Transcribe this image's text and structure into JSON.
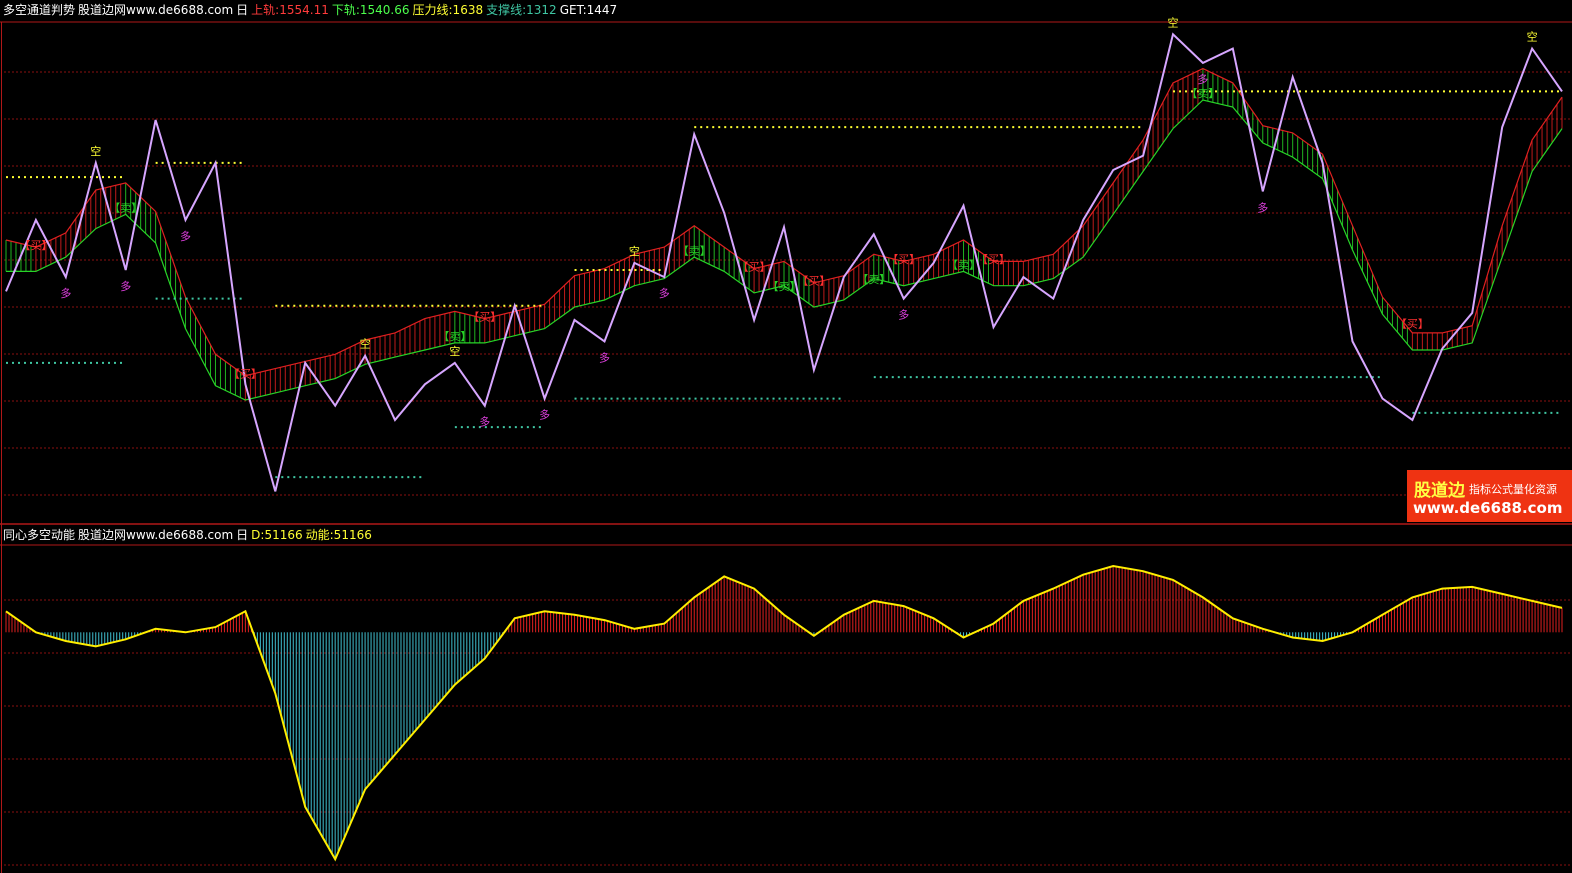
{
  "top_header": {
    "name": "多空通道判势",
    "source": "股道边网www.de6688.com",
    "period": "日",
    "upper_label": "上轨:1554.11",
    "lower_label": "下轨:1540.66",
    "pressure_label": "压力线:1638",
    "support_label": "支撑线:1312",
    "get_label": "GET:1447"
  },
  "bottom_header": {
    "name": "同心多空动能",
    "source": "股道边网www.de6688.com",
    "period": "日",
    "d_label": "D:51166",
    "momentum_label": "动能:51166"
  },
  "watermark": {
    "brand": "股道边",
    "tagline": "指标公式量化资源",
    "url": "www.de6688.com"
  },
  "signals": {
    "buy": "多",
    "sell": "空",
    "sell_box": "【卖】",
    "buy_box": "【买】"
  },
  "colors": {
    "price_line": "#d6a6ff",
    "band_red": "#e02020",
    "band_green": "#27d427",
    "pressure": "#ffff33",
    "support": "#3fc6a3",
    "momentum_line": "#ffee00",
    "momentum_pos": "#e02020",
    "momentum_neg": "#40c0d0",
    "grid": "#8a1010"
  },
  "chart_data": [
    {
      "type": "line",
      "title": "多空通道判势",
      "x": [
        0,
        5,
        10,
        15,
        20,
        25,
        30,
        35,
        40,
        45,
        50,
        55,
        60,
        65,
        70,
        75,
        80,
        85,
        90,
        95,
        100,
        105,
        110,
        115,
        120,
        125,
        130,
        135,
        140,
        145,
        150,
        155,
        160,
        165,
        170,
        175,
        180,
        185,
        190,
        195,
        200,
        205,
        210,
        215,
        220,
        225,
        230,
        235,
        240,
        245,
        250,
        255,
        260
      ],
      "series": [
        {
          "role": "price",
          "values": [
            1420,
            1520,
            1440,
            1600,
            1450,
            1660,
            1520,
            1600,
            1290,
            1140,
            1320,
            1260,
            1330,
            1240,
            1290,
            1320,
            1260,
            1400,
            1270,
            1380,
            1350,
            1460,
            1440,
            1640,
            1530,
            1380,
            1510,
            1310,
            1440,
            1500,
            1410,
            1460,
            1540,
            1370,
            1440,
            1410,
            1520,
            1590,
            1610,
            1780,
            1740,
            1760,
            1560,
            1720,
            1600,
            1350,
            1270,
            1240,
            1340,
            1390,
            1650,
            1760,
            1700
          ]
        },
        {
          "role": "band_upper",
          "values": [
            1480,
            1470,
            1490,
            1550,
            1560,
            1520,
            1400,
            1320,
            1290,
            1300,
            1310,
            1320,
            1340,
            1350,
            1370,
            1380,
            1370,
            1380,
            1390,
            1430,
            1440,
            1460,
            1470,
            1500,
            1470,
            1440,
            1450,
            1420,
            1430,
            1460,
            1450,
            1460,
            1480,
            1450,
            1450,
            1460,
            1500,
            1560,
            1620,
            1700,
            1720,
            1700,
            1640,
            1630,
            1600,
            1500,
            1400,
            1350,
            1350,
            1360,
            1500,
            1620,
            1680
          ]
        },
        {
          "role": "band_lower",
          "values": [
            1460,
            1460,
            1480,
            1520,
            1540,
            1500,
            1380,
            1300,
            1280,
            1290,
            1300,
            1310,
            1330,
            1340,
            1350,
            1360,
            1360,
            1370,
            1380,
            1410,
            1420,
            1440,
            1450,
            1480,
            1460,
            1430,
            1440,
            1410,
            1420,
            1450,
            1440,
            1450,
            1460,
            1440,
            1440,
            1450,
            1480,
            1540,
            1600,
            1660,
            1700,
            1690,
            1640,
            1620,
            1590,
            1490,
            1400,
            1350,
            1350,
            1360,
            1480,
            1600,
            1660
          ]
        },
        {
          "role": "pressure",
          "values": [
            1580,
            1580,
            1580,
            1580,
            1580,
            1600,
            1600,
            1600,
            1600,
            1400,
            1400,
            1400,
            1400,
            1400,
            1400,
            1400,
            1400,
            1400,
            1400,
            1450,
            1450,
            1450,
            1450,
            1650,
            1650,
            1650,
            1650,
            1650,
            1650,
            1650,
            1650,
            1650,
            1650,
            1650,
            1650,
            1650,
            1650,
            1650,
            1650,
            1700,
            1700,
            1700,
            1700,
            1700,
            1700,
            1700,
            1700,
            1700,
            1700,
            1700,
            1700,
            1700,
            1700
          ]
        },
        {
          "role": "support",
          "values": [
            1320,
            1320,
            1320,
            1320,
            1320,
            1410,
            1410,
            1410,
            1410,
            1160,
            1160,
            1160,
            1160,
            1160,
            1160,
            1230,
            1230,
            1230,
            1230,
            1270,
            1270,
            1270,
            1270,
            1270,
            1270,
            1270,
            1270,
            1270,
            1270,
            1300,
            1300,
            1300,
            1300,
            1300,
            1300,
            1300,
            1300,
            1300,
            1300,
            1300,
            1300,
            1300,
            1300,
            1300,
            1300,
            1300,
            1300,
            1250,
            1250,
            1250,
            1250,
            1250,
            1250
          ]
        }
      ],
      "ylim": [
        1100,
        1800
      ]
    },
    {
      "type": "bar",
      "title": "同心多空动能",
      "x": [
        0,
        5,
        10,
        15,
        20,
        25,
        30,
        35,
        40,
        45,
        50,
        55,
        60,
        65,
        70,
        75,
        80,
        85,
        90,
        95,
        100,
        105,
        110,
        115,
        120,
        125,
        130,
        135,
        140,
        145,
        150,
        155,
        160,
        165,
        170,
        175,
        180,
        185,
        190,
        195,
        200,
        205,
        210,
        215,
        220,
        225,
        230,
        235,
        240,
        245,
        250,
        255,
        260
      ],
      "values": [
        12,
        0,
        -5,
        -8,
        -4,
        2,
        0,
        3,
        12,
        -35,
        -100,
        -130,
        -90,
        -70,
        -50,
        -30,
        -15,
        8,
        12,
        10,
        7,
        2,
        5,
        20,
        32,
        25,
        10,
        -2,
        10,
        18,
        15,
        8,
        -3,
        5,
        18,
        25,
        33,
        38,
        35,
        30,
        20,
        8,
        2,
        -3,
        -5,
        0,
        10,
        20,
        25,
        26,
        22,
        18,
        14
      ],
      "ylim": [
        -135,
        50
      ]
    }
  ]
}
